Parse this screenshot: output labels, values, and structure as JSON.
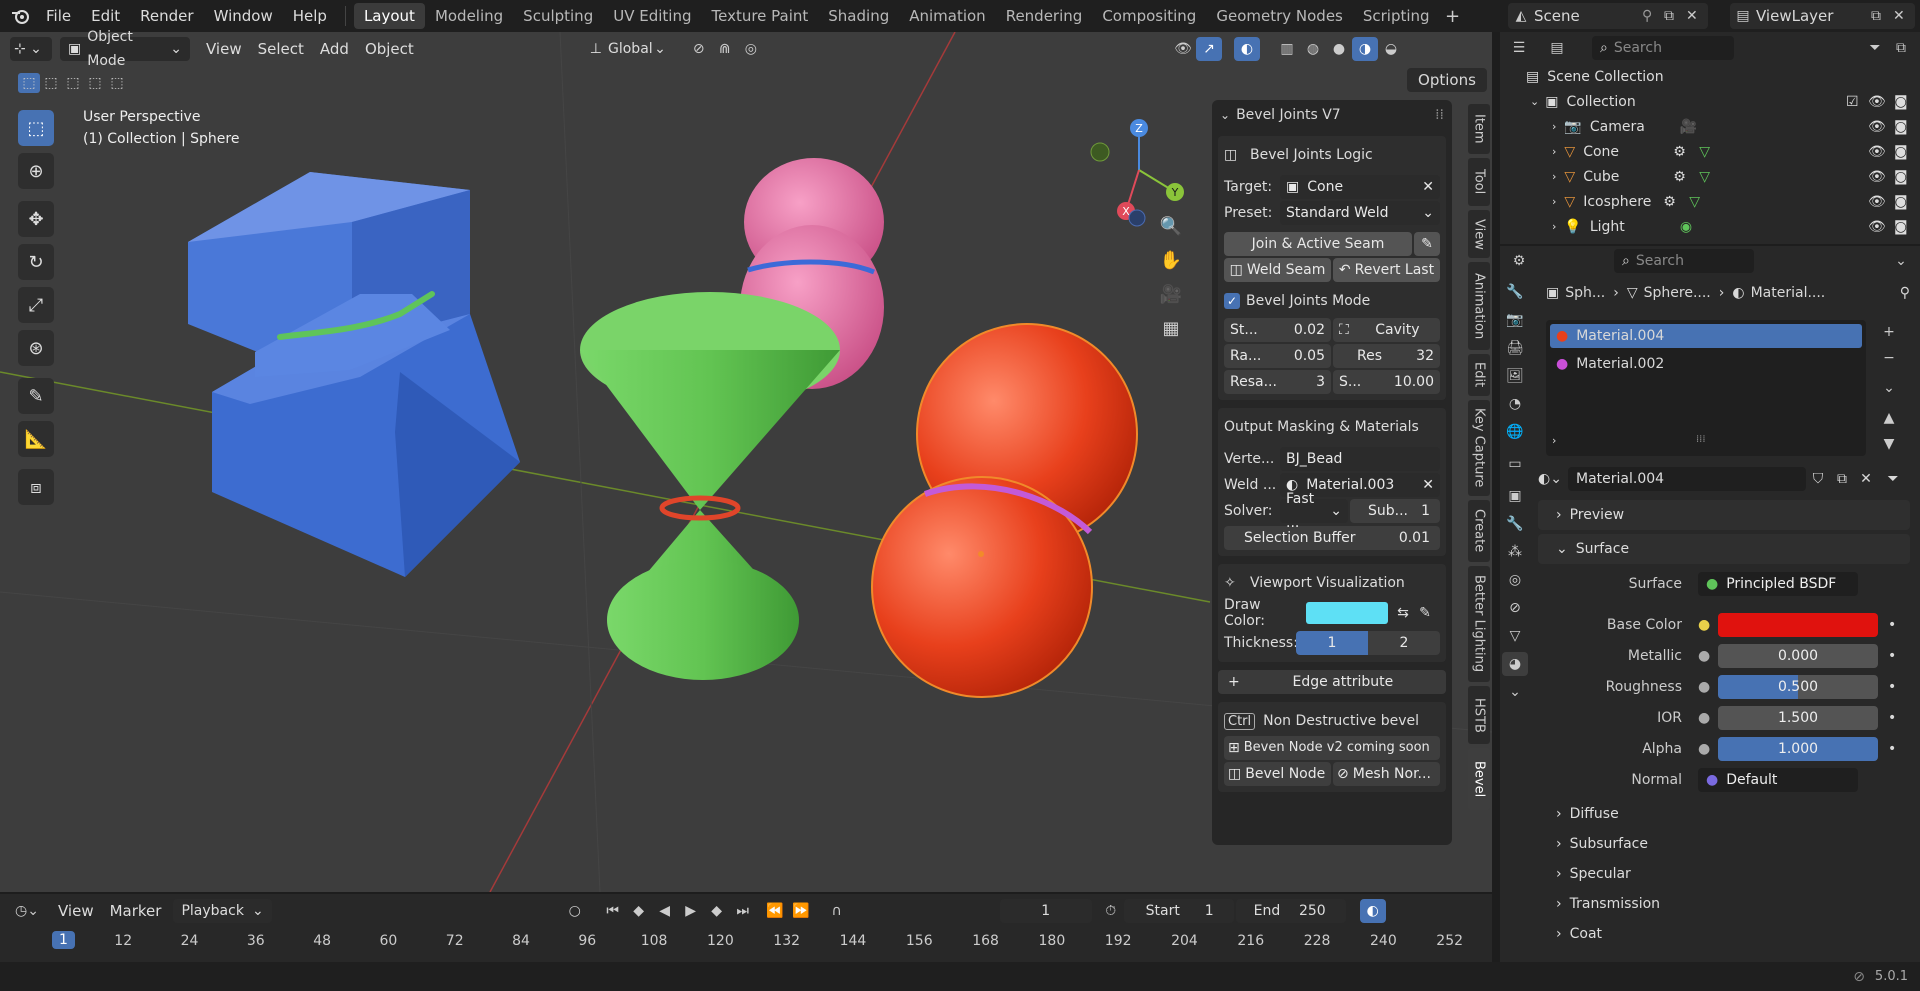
{
  "topbar": {
    "menus": [
      "File",
      "Edit",
      "Render",
      "Window",
      "Help"
    ],
    "workspaces": [
      "Layout",
      "Modeling",
      "Sculpting",
      "UV Editing",
      "Texture Paint",
      "Shading",
      "Animation",
      "Rendering",
      "Compositing",
      "Geometry Nodes",
      "Scripting"
    ],
    "scene": "Scene",
    "view_layer": "ViewLayer"
  },
  "viewport": {
    "mode": "Object Mode",
    "menus": [
      "View",
      "Select",
      "Add",
      "Object"
    ],
    "orientation": "Global",
    "options": "Options",
    "info_line1": "User Perspective",
    "info_line2": "(1) Collection | Sphere"
  },
  "npanel": {
    "title": "Bevel Joints V7",
    "logic_title": "Bevel Joints Logic",
    "target_label": "Target:",
    "target_value": "Cone",
    "preset_label": "Preset:",
    "preset_value": "Standard Weld",
    "join_btn": "Join & Active Seam",
    "weld_btn": "Weld Seam",
    "revert_btn": "Revert Last",
    "mode_label": "Bevel Joints Mode",
    "grid": [
      [
        "St...",
        "0.02",
        "Cavity",
        ""
      ],
      [
        "Ra...",
        "0.05",
        "Res",
        "32"
      ],
      [
        "Resa...",
        "3",
        "S...",
        "10.00"
      ]
    ],
    "output_title": "Output Masking & Materials",
    "verte_label": "Verte...",
    "verte_value": "BJ_Bead",
    "weld_label": "Weld ...",
    "weld_value": "Material.003",
    "solver_label": "Solver:",
    "solver_value": "Fast ...",
    "sub_label": "Sub...",
    "sub_value": "1",
    "sel_buffer_label": "Selection Buffer",
    "sel_buffer_value": "0.01",
    "vis_title": "Viewport Visualization",
    "draw_color_label": "Draw Color:",
    "draw_color": "#5ee0f5",
    "thickness_label": "Thickness:",
    "thickness_1": "1",
    "thickness_2": "2",
    "edge_attr": "Edge attribute",
    "ctrl_label": "Ctrl",
    "nondestructive": "Non Destructive bevel",
    "bevel_node_v2": "Beven Node v2 coming soon",
    "bevel_node": "Bevel Node",
    "mesh_nor": "Mesh Nor..."
  },
  "vtabs": [
    "Item",
    "Tool",
    "View",
    "Animation",
    "Edit",
    "Key Capture",
    "Create",
    "Better Lighting",
    "HSTB",
    "Bevel"
  ],
  "outliner": {
    "search_placeholder": "Search",
    "scene_collection": "Scene Collection",
    "collection": "Collection",
    "items": [
      "Camera",
      "Cone",
      "Cube",
      "Icosphere",
      "Light"
    ]
  },
  "properties": {
    "search_placeholder": "Search",
    "breadcrumb": [
      "Sph...",
      "Sphere....",
      "Material...."
    ],
    "materials": [
      "Material.004",
      "Material.002"
    ],
    "active_material": "Material.004",
    "sections": {
      "preview": "Preview",
      "surface": "Surface"
    },
    "surface_label": "Surface",
    "surface_value": "Principled BSDF",
    "rows": [
      {
        "label": "Base Color",
        "value": "",
        "color": "#e0120e"
      },
      {
        "label": "Metallic",
        "value": "0.000"
      },
      {
        "label": "Roughness",
        "value": "0.500",
        "fill": 0.5
      },
      {
        "label": "IOR",
        "value": "1.500"
      },
      {
        "label": "Alpha",
        "value": "1.000",
        "fill": 1.0
      }
    ],
    "normal_label": "Normal",
    "normal_value": "Default",
    "subsections": [
      "Diffuse",
      "Subsurface",
      "Specular",
      "Transmission",
      "Coat"
    ]
  },
  "timeline": {
    "menus": [
      "View",
      "Marker",
      "Playback"
    ],
    "current_frame": "1",
    "start_label": "Start",
    "start": "1",
    "end_label": "End",
    "end": "250",
    "ticks": [
      "1",
      "12",
      "24",
      "36",
      "48",
      "60",
      "72",
      "84",
      "96",
      "108",
      "120",
      "132",
      "144",
      "156",
      "168",
      "180",
      "192",
      "204",
      "216",
      "228",
      "240",
      "252"
    ]
  },
  "statusbar": {
    "version": "5.0.1"
  }
}
